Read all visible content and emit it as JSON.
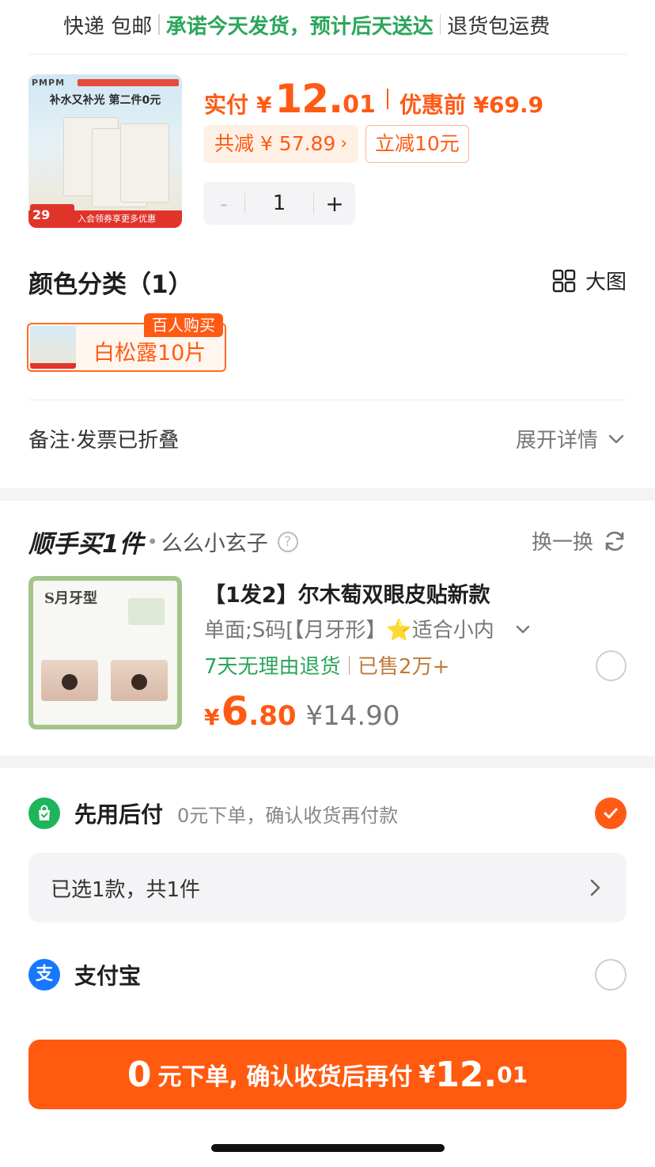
{
  "shipping": {
    "method": "快递 包邮",
    "promise": "承诺今天发货，预计后天送达",
    "return_fee": "退货包运费"
  },
  "product": {
    "thumb": {
      "brand": "PMPM",
      "headline": "补水又补光 第二件0元",
      "footer": "入会领券享更多优惠",
      "footer_price": "29"
    },
    "pay_label": "实付",
    "currency": "¥",
    "price_int": "12.",
    "price_dec": "01",
    "orig_price": "优惠前 ¥69.9",
    "discount_tag": "共减 ¥ 57.89",
    "instant_tag": "立减10元",
    "quantity": "1",
    "minus": "-",
    "plus": "+"
  },
  "color_section": {
    "title": "颜色分类（1）",
    "big_view": "大图",
    "variant_label": "白松露10片",
    "variant_badge": "百人购买"
  },
  "notes": {
    "label": "备注·发票已折叠",
    "expand": "展开详情"
  },
  "addon": {
    "header_title": "顺手买",
    "header_count": "1件",
    "dot": "•",
    "seller": "么么小玄子",
    "swap": "换一换",
    "thumb_s": "S月牙型",
    "title": "【1发2】尔木萄双眼皮贴新款",
    "spec": "单面;S码[【月牙形】⭐适合小内",
    "return_policy": "7天无理由退货",
    "sold": "已售2万+",
    "currency": "¥",
    "price_int": "6",
    "price_dec": ".80",
    "orig_price": "¥14.90"
  },
  "payment": {
    "bnpl_name": "先用后付",
    "bnpl_desc": "0元下单，确认收货再付款",
    "bnpl_selected": true,
    "selected_summary": "已选1款，共1件",
    "alipay_name": "支付宝",
    "alipay_selected": false
  },
  "cta": {
    "zero": "0",
    "text": "元下单, 确认收货后再付",
    "currency": "¥",
    "price_int": "12.",
    "price_dec": "01"
  },
  "colors": {
    "accent": "#ff5a14",
    "green": "#2aa65a",
    "alipay_blue": "#1677ff",
    "bnpl_green": "#1fb45a"
  }
}
